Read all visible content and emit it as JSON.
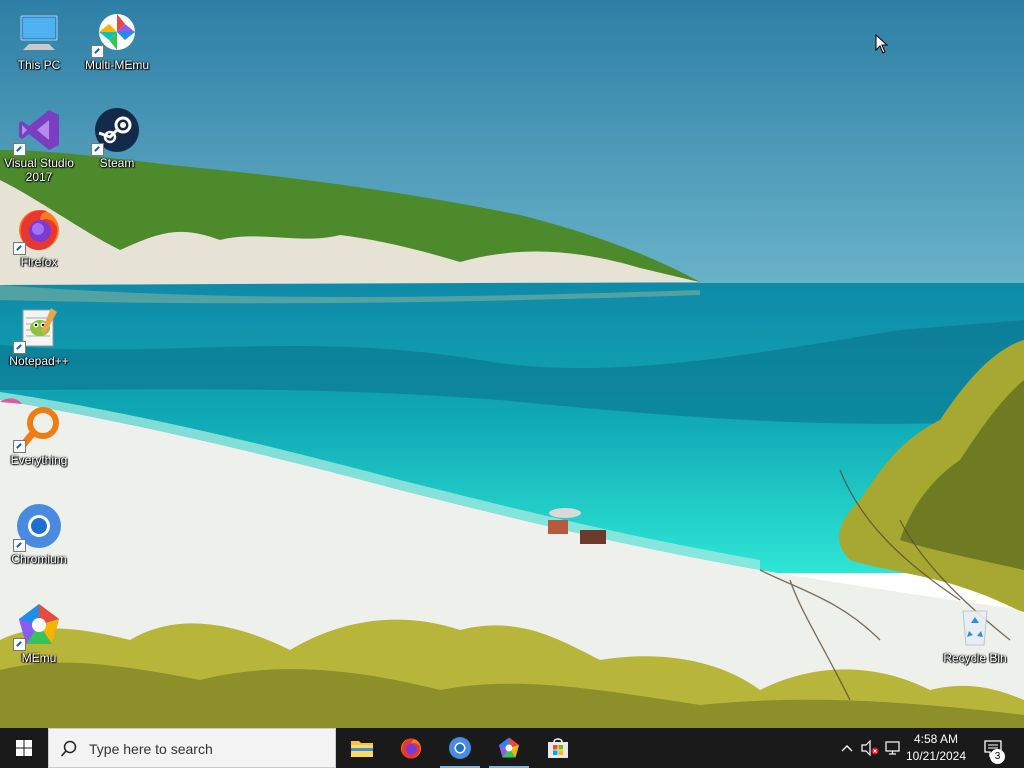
{
  "desktop": {
    "icons": [
      {
        "label": "This PC",
        "icon": "this-pc-icon"
      },
      {
        "label": "Multi-MEmu",
        "icon": "multi-memu-icon"
      },
      {
        "label": "Visual Studio 2017",
        "icon": "visual-studio-icon"
      },
      {
        "label": "Steam",
        "icon": "steam-icon"
      },
      {
        "label": "Firefox",
        "icon": "firefox-icon"
      },
      {
        "label": "Notepad++",
        "icon": "notepad-plus-plus-icon"
      },
      {
        "label": "Everything",
        "icon": "everything-search-icon"
      },
      {
        "label": "Chromium",
        "icon": "chromium-icon"
      },
      {
        "label": "MEmu",
        "icon": "memu-icon"
      },
      {
        "label": "Recycle Bin",
        "icon": "recycle-bin-icon"
      }
    ]
  },
  "taskbar": {
    "search_placeholder": "Type here to search",
    "pinned": [
      "file-explorer-icon",
      "firefox-icon",
      "chromium-icon",
      "multi-memu-icon",
      "microsoft-store-icon"
    ],
    "clock": {
      "time": "4:58 AM",
      "date": "10/21/2024"
    },
    "notification_count": "3"
  },
  "colors": {
    "taskbar_bg": "#1a1a1a",
    "sky": "#3d8fb5",
    "sea": "#1fd1c8",
    "sand": "#eef0ec"
  }
}
